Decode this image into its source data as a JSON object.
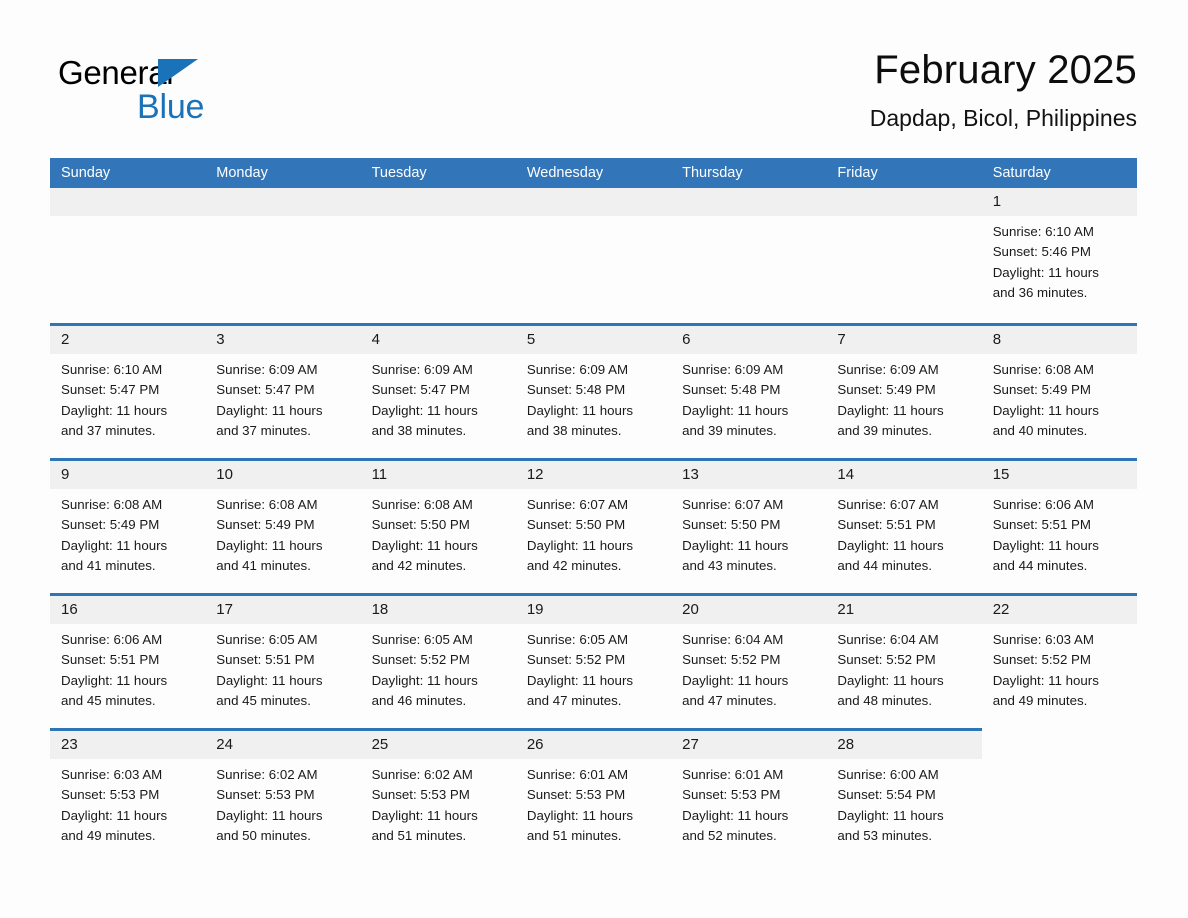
{
  "brand": {
    "name_dark": "General",
    "name_light": "Blue",
    "flag_icon": "triangle-flag-icon",
    "accent_color": "#1a72b8"
  },
  "header": {
    "title": "February 2025",
    "location": "Dapdap, Bicol, Philippines"
  },
  "calendar": {
    "header_bg": "#3275b8",
    "row_border_color": "#2e75b6",
    "daynum_band_bg": "#f0f0f0",
    "weekdays": [
      "Sunday",
      "Monday",
      "Tuesday",
      "Wednesday",
      "Thursday",
      "Friday",
      "Saturday"
    ],
    "weeks": [
      [
        {
          "day": "",
          "sunrise": "",
          "sunset": "",
          "daylight_1": "",
          "daylight_2": "",
          "empty": true
        },
        {
          "day": "",
          "sunrise": "",
          "sunset": "",
          "daylight_1": "",
          "daylight_2": "",
          "empty": true
        },
        {
          "day": "",
          "sunrise": "",
          "sunset": "",
          "daylight_1": "",
          "daylight_2": "",
          "empty": true
        },
        {
          "day": "",
          "sunrise": "",
          "sunset": "",
          "daylight_1": "",
          "daylight_2": "",
          "empty": true
        },
        {
          "day": "",
          "sunrise": "",
          "sunset": "",
          "daylight_1": "",
          "daylight_2": "",
          "empty": true
        },
        {
          "day": "",
          "sunrise": "",
          "sunset": "",
          "daylight_1": "",
          "daylight_2": "",
          "empty": true
        },
        {
          "day": "1",
          "sunrise": "Sunrise: 6:10 AM",
          "sunset": "Sunset: 5:46 PM",
          "daylight_1": "Daylight: 11 hours",
          "daylight_2": "and 36 minutes.",
          "empty": false
        }
      ],
      [
        {
          "day": "2",
          "sunrise": "Sunrise: 6:10 AM",
          "sunset": "Sunset: 5:47 PM",
          "daylight_1": "Daylight: 11 hours",
          "daylight_2": "and 37 minutes.",
          "empty": false
        },
        {
          "day": "3",
          "sunrise": "Sunrise: 6:09 AM",
          "sunset": "Sunset: 5:47 PM",
          "daylight_1": "Daylight: 11 hours",
          "daylight_2": "and 37 minutes.",
          "empty": false
        },
        {
          "day": "4",
          "sunrise": "Sunrise: 6:09 AM",
          "sunset": "Sunset: 5:47 PM",
          "daylight_1": "Daylight: 11 hours",
          "daylight_2": "and 38 minutes.",
          "empty": false
        },
        {
          "day": "5",
          "sunrise": "Sunrise: 6:09 AM",
          "sunset": "Sunset: 5:48 PM",
          "daylight_1": "Daylight: 11 hours",
          "daylight_2": "and 38 minutes.",
          "empty": false
        },
        {
          "day": "6",
          "sunrise": "Sunrise: 6:09 AM",
          "sunset": "Sunset: 5:48 PM",
          "daylight_1": "Daylight: 11 hours",
          "daylight_2": "and 39 minutes.",
          "empty": false
        },
        {
          "day": "7",
          "sunrise": "Sunrise: 6:09 AM",
          "sunset": "Sunset: 5:49 PM",
          "daylight_1": "Daylight: 11 hours",
          "daylight_2": "and 39 minutes.",
          "empty": false
        },
        {
          "day": "8",
          "sunrise": "Sunrise: 6:08 AM",
          "sunset": "Sunset: 5:49 PM",
          "daylight_1": "Daylight: 11 hours",
          "daylight_2": "and 40 minutes.",
          "empty": false
        }
      ],
      [
        {
          "day": "9",
          "sunrise": "Sunrise: 6:08 AM",
          "sunset": "Sunset: 5:49 PM",
          "daylight_1": "Daylight: 11 hours",
          "daylight_2": "and 41 minutes.",
          "empty": false
        },
        {
          "day": "10",
          "sunrise": "Sunrise: 6:08 AM",
          "sunset": "Sunset: 5:49 PM",
          "daylight_1": "Daylight: 11 hours",
          "daylight_2": "and 41 minutes.",
          "empty": false
        },
        {
          "day": "11",
          "sunrise": "Sunrise: 6:08 AM",
          "sunset": "Sunset: 5:50 PM",
          "daylight_1": "Daylight: 11 hours",
          "daylight_2": "and 42 minutes.",
          "empty": false
        },
        {
          "day": "12",
          "sunrise": "Sunrise: 6:07 AM",
          "sunset": "Sunset: 5:50 PM",
          "daylight_1": "Daylight: 11 hours",
          "daylight_2": "and 42 minutes.",
          "empty": false
        },
        {
          "day": "13",
          "sunrise": "Sunrise: 6:07 AM",
          "sunset": "Sunset: 5:50 PM",
          "daylight_1": "Daylight: 11 hours",
          "daylight_2": "and 43 minutes.",
          "empty": false
        },
        {
          "day": "14",
          "sunrise": "Sunrise: 6:07 AM",
          "sunset": "Sunset: 5:51 PM",
          "daylight_1": "Daylight: 11 hours",
          "daylight_2": "and 44 minutes.",
          "empty": false
        },
        {
          "day": "15",
          "sunrise": "Sunrise: 6:06 AM",
          "sunset": "Sunset: 5:51 PM",
          "daylight_1": "Daylight: 11 hours",
          "daylight_2": "and 44 minutes.",
          "empty": false
        }
      ],
      [
        {
          "day": "16",
          "sunrise": "Sunrise: 6:06 AM",
          "sunset": "Sunset: 5:51 PM",
          "daylight_1": "Daylight: 11 hours",
          "daylight_2": "and 45 minutes.",
          "empty": false
        },
        {
          "day": "17",
          "sunrise": "Sunrise: 6:05 AM",
          "sunset": "Sunset: 5:51 PM",
          "daylight_1": "Daylight: 11 hours",
          "daylight_2": "and 45 minutes.",
          "empty": false
        },
        {
          "day": "18",
          "sunrise": "Sunrise: 6:05 AM",
          "sunset": "Sunset: 5:52 PM",
          "daylight_1": "Daylight: 11 hours",
          "daylight_2": "and 46 minutes.",
          "empty": false
        },
        {
          "day": "19",
          "sunrise": "Sunrise: 6:05 AM",
          "sunset": "Sunset: 5:52 PM",
          "daylight_1": "Daylight: 11 hours",
          "daylight_2": "and 47 minutes.",
          "empty": false
        },
        {
          "day": "20",
          "sunrise": "Sunrise: 6:04 AM",
          "sunset": "Sunset: 5:52 PM",
          "daylight_1": "Daylight: 11 hours",
          "daylight_2": "and 47 minutes.",
          "empty": false
        },
        {
          "day": "21",
          "sunrise": "Sunrise: 6:04 AM",
          "sunset": "Sunset: 5:52 PM",
          "daylight_1": "Daylight: 11 hours",
          "daylight_2": "and 48 minutes.",
          "empty": false
        },
        {
          "day": "22",
          "sunrise": "Sunrise: 6:03 AM",
          "sunset": "Sunset: 5:52 PM",
          "daylight_1": "Daylight: 11 hours",
          "daylight_2": "and 49 minutes.",
          "empty": false
        }
      ],
      [
        {
          "day": "23",
          "sunrise": "Sunrise: 6:03 AM",
          "sunset": "Sunset: 5:53 PM",
          "daylight_1": "Daylight: 11 hours",
          "daylight_2": "and 49 minutes.",
          "empty": false
        },
        {
          "day": "24",
          "sunrise": "Sunrise: 6:02 AM",
          "sunset": "Sunset: 5:53 PM",
          "daylight_1": "Daylight: 11 hours",
          "daylight_2": "and 50 minutes.",
          "empty": false
        },
        {
          "day": "25",
          "sunrise": "Sunrise: 6:02 AM",
          "sunset": "Sunset: 5:53 PM",
          "daylight_1": "Daylight: 11 hours",
          "daylight_2": "and 51 minutes.",
          "empty": false
        },
        {
          "day": "26",
          "sunrise": "Sunrise: 6:01 AM",
          "sunset": "Sunset: 5:53 PM",
          "daylight_1": "Daylight: 11 hours",
          "daylight_2": "and 51 minutes.",
          "empty": false
        },
        {
          "day": "27",
          "sunrise": "Sunrise: 6:01 AM",
          "sunset": "Sunset: 5:53 PM",
          "daylight_1": "Daylight: 11 hours",
          "daylight_2": "and 52 minutes.",
          "empty": false
        },
        {
          "day": "28",
          "sunrise": "Sunrise: 6:00 AM",
          "sunset": "Sunset: 5:54 PM",
          "daylight_1": "Daylight: 11 hours",
          "daylight_2": "and 53 minutes.",
          "empty": false
        },
        {
          "day": "",
          "sunrise": "",
          "sunset": "",
          "daylight_1": "",
          "daylight_2": "",
          "empty": true
        }
      ]
    ]
  }
}
